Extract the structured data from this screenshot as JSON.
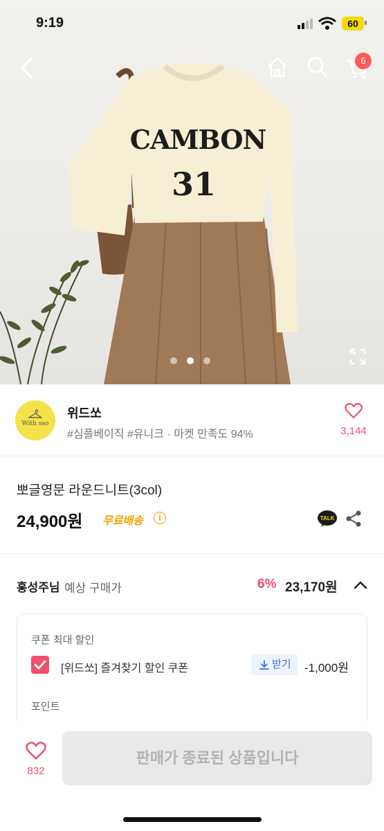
{
  "status_bar": {
    "time": "9:19",
    "battery": "60"
  },
  "nav": {
    "cart_count": "6"
  },
  "gallery": {
    "slide_count": 3,
    "active_index": 1
  },
  "shop": {
    "name": "위드쏘",
    "tags_meta": "#심플베이직 #유니크 · 마켓 만족도 94%",
    "likes": "3,144"
  },
  "product": {
    "title": "뽀글영문 라운드니트(3col)",
    "price": "24,900원",
    "shipping": "무료배송",
    "talk_label": "TALK"
  },
  "expected_price": {
    "user": "홍성주님",
    "label": "예상 구매가",
    "discount": "6%",
    "price": "23,170원"
  },
  "coupon": {
    "heading": "쿠폰 최대 할인",
    "name": "[위드쏘] 즐겨찾기 할인 쿠폰",
    "download_label": "받기",
    "amount": "-1,000원",
    "point_heading": "포인트"
  },
  "bottom_bar": {
    "likes": "832",
    "status_button": "판매가 종료된 상품입니다"
  },
  "colors": {
    "accent_pink": "#f0506e",
    "shipping_orange": "#f2a300",
    "download_blue": "#3b6fe0"
  }
}
